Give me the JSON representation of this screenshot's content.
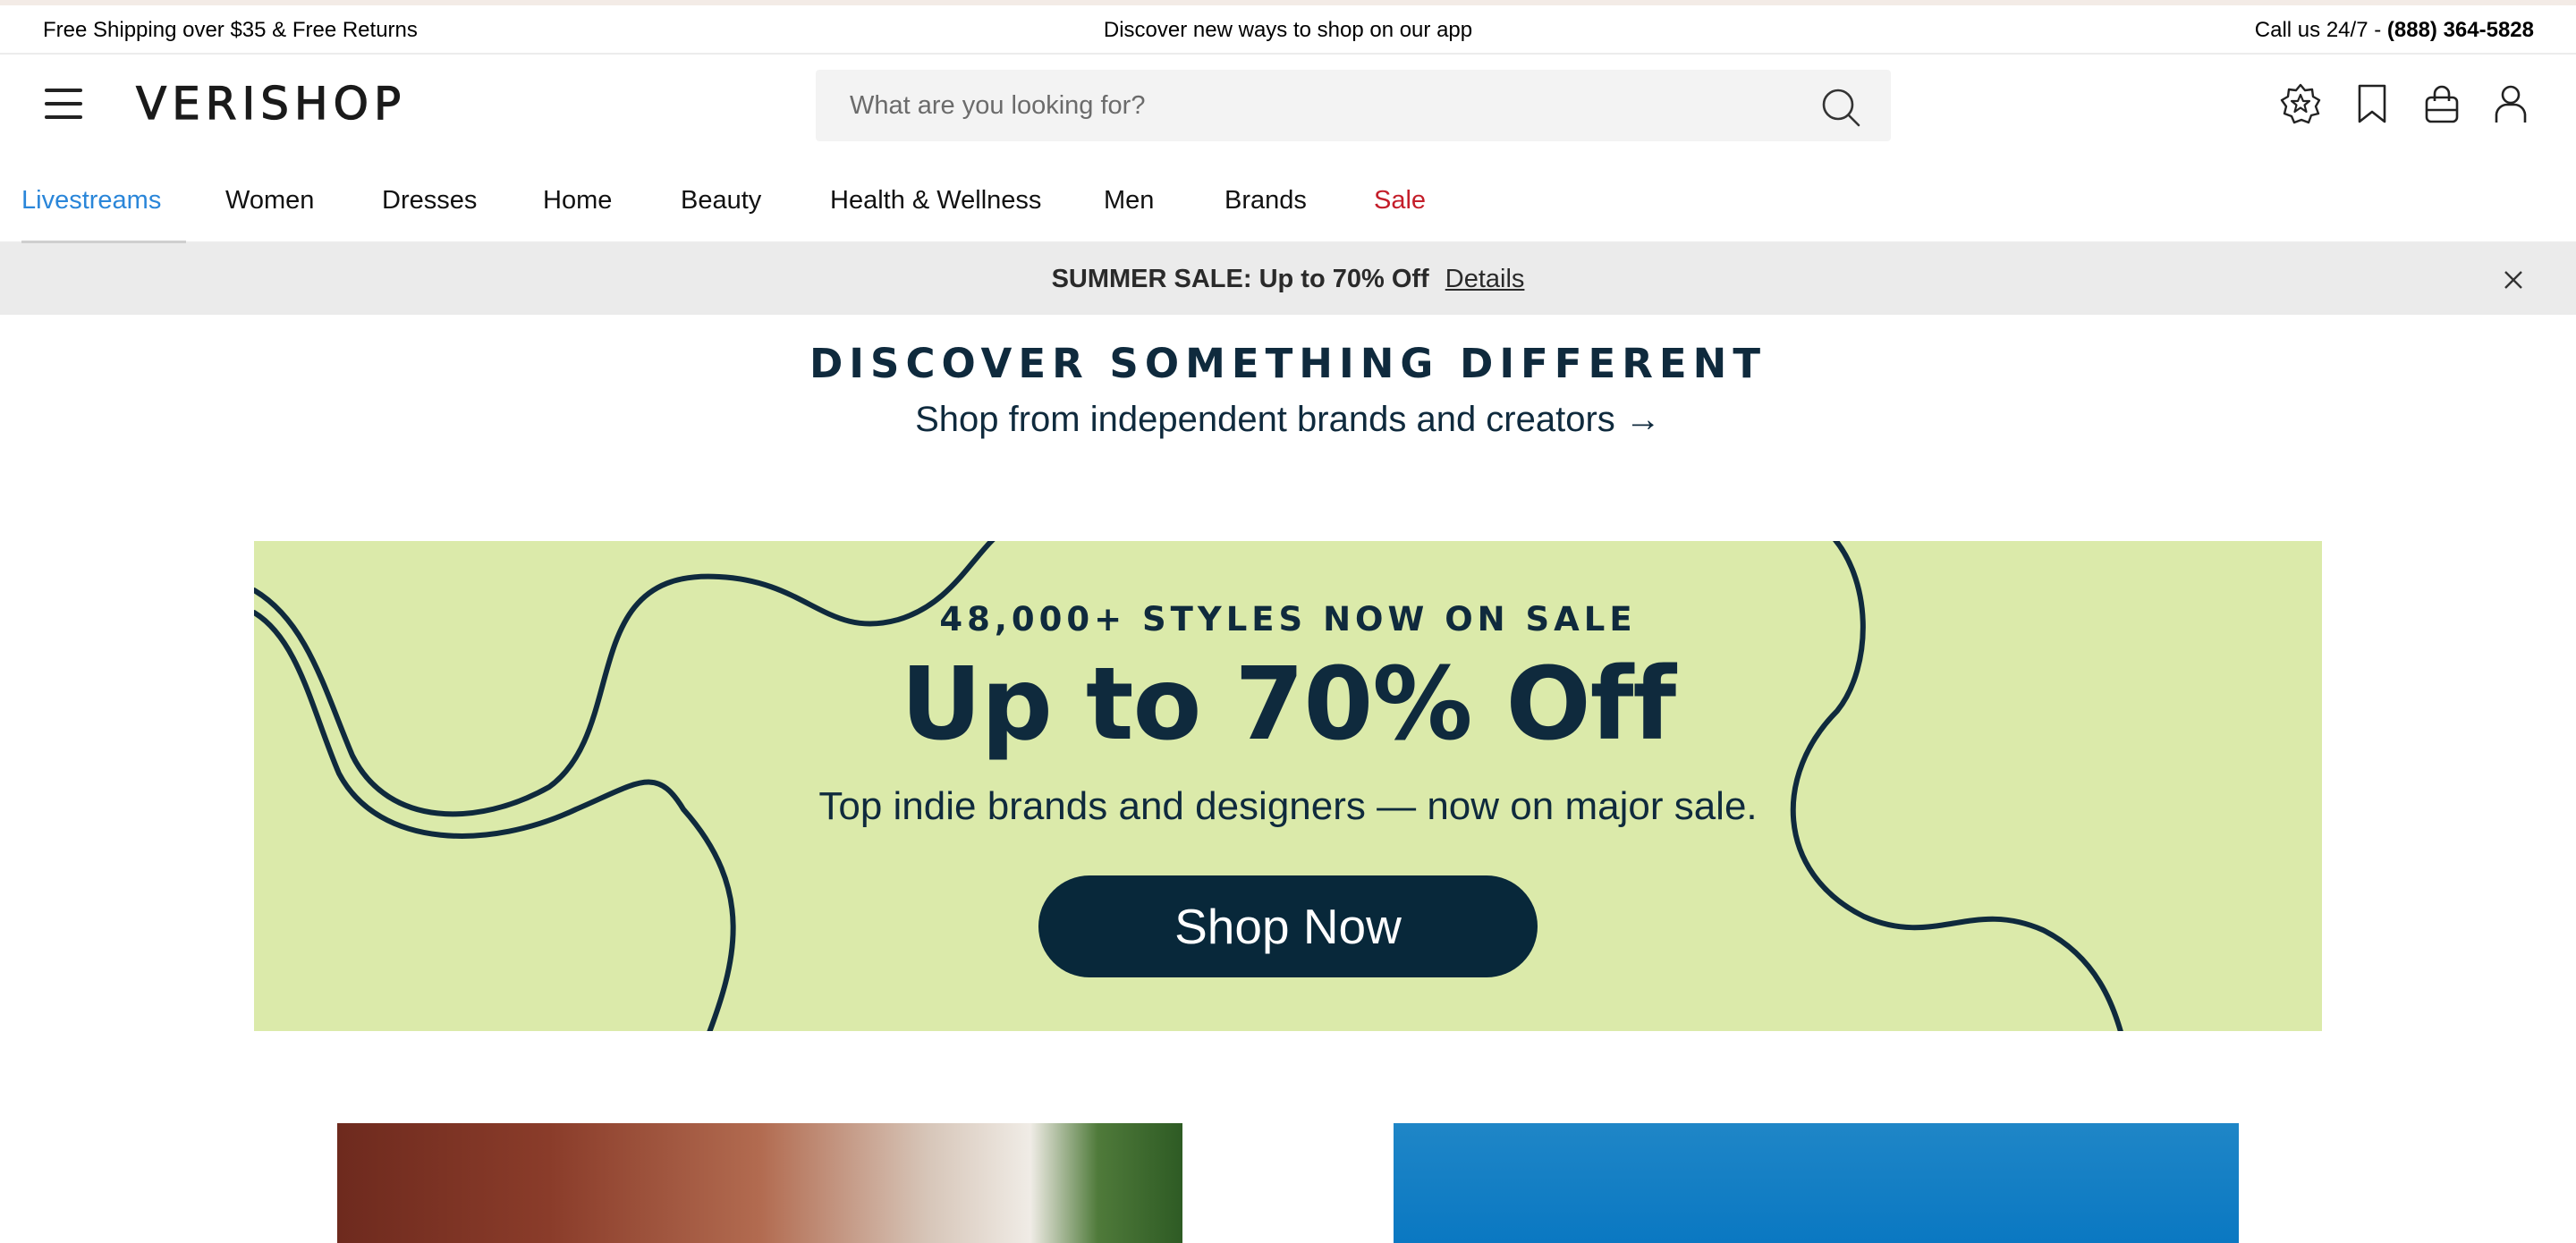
{
  "promo_bar": {
    "left": "Free Shipping over $35 & Free Returns",
    "center": "Discover new ways to shop on our app",
    "right_prefix": "Call us 24/7 - ",
    "right_phone": "(888) 364-5828"
  },
  "header": {
    "logo": "VERISHOP",
    "search_placeholder": "What are you looking for?",
    "icons": [
      "menu-icon",
      "search-icon",
      "rewards-star-icon",
      "bookmark-icon",
      "shopping-bag-icon",
      "account-icon"
    ]
  },
  "nav": {
    "items": [
      {
        "label": "Livestreams"
      },
      {
        "label": "Women"
      },
      {
        "label": "Dresses"
      },
      {
        "label": "Home"
      },
      {
        "label": "Beauty"
      },
      {
        "label": "Health & Wellness"
      },
      {
        "label": "Men"
      },
      {
        "label": "Brands"
      },
      {
        "label": "Sale"
      }
    ],
    "active_color": "#2a86d9",
    "sale_color": "#c41e2a"
  },
  "sale_banner": {
    "text": "SUMMER SALE: Up to 70% Off",
    "link": "Details"
  },
  "discover": {
    "title": "DISCOVER SOMETHING DIFFERENT",
    "subtitle": "Shop from independent brands and creators →"
  },
  "hero": {
    "eyebrow": "48,000+ STYLES NOW ON SALE",
    "title": "Up to 70% Off",
    "subtitle": "Top indie brands and designers — now on major sale.",
    "button": "Shop Now",
    "background": "#dbeaaa",
    "ink": "#0f2a3d"
  },
  "colors": {
    "button_bg": "#08283a",
    "banner_bg": "#ebebeb"
  }
}
